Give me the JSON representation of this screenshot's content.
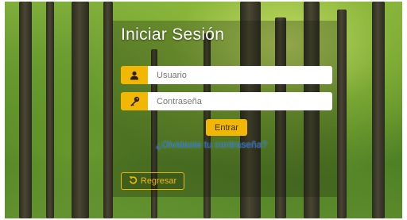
{
  "login": {
    "title": "Iniciar Sesión",
    "username": {
      "placeholder": "Usuario",
      "value": "",
      "icon": "user-icon"
    },
    "password": {
      "placeholder": "Contraseña",
      "value": "",
      "icon": "key-icon"
    },
    "submit_label": "Entrar",
    "forgot_label": "¿Olvidaste tu contraseña?",
    "back_label": "Regresar",
    "back_icon": "undo-arrow-icon"
  },
  "colors": {
    "accent": "#f2b705",
    "link": "#1a6fd8",
    "title": "#ffffff"
  }
}
